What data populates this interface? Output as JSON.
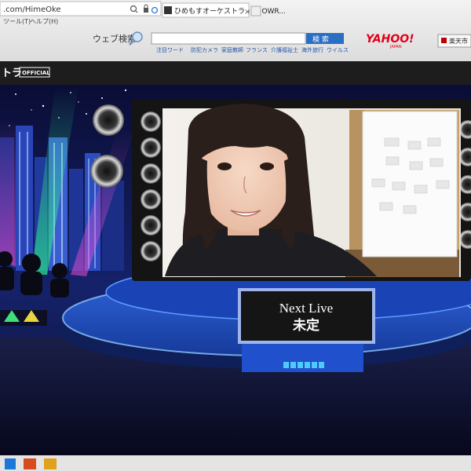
{
  "browser": {
    "address_fragment": ".com/HimeOke",
    "tab_title": "ひめもすオーケストラ - SHOWR...",
    "menu_items": [
      "ツール(T)",
      "ヘルプ(H)"
    ],
    "search_label": "ウェブ検索",
    "search_button": "検 索",
    "logo_text": "YAHOO!",
    "logo_sub": "JAPAN",
    "rakuten_label": "楽天市",
    "quick_links": [
      "注目ワード",
      "防犯カメラ",
      "家庭教師",
      "フランス",
      "介護福祉士",
      "海外旅行",
      "ウイルス"
    ]
  },
  "page": {
    "title_fragment": "トラ",
    "official_badge": "OFFICIAL"
  },
  "stage": {
    "sign_line1": "Next Live",
    "sign_line2": "未定"
  },
  "colors": {
    "stage_blue": "#1c3fae",
    "night_sky": "#0b1030",
    "yahoo_red": "#e2001a",
    "search_button": "#2b6fc4"
  }
}
